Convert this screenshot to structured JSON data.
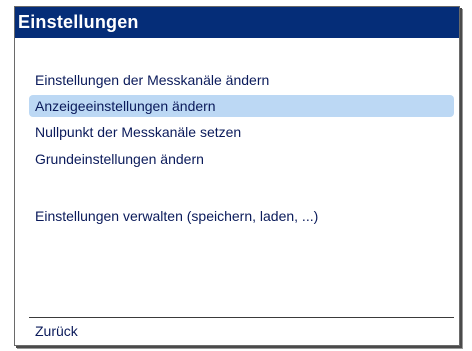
{
  "window": {
    "title": "Einstellungen"
  },
  "menu": {
    "items": [
      {
        "label": "Einstellungen der Messkanäle ändern",
        "selected": false
      },
      {
        "label": "Anzeigeeinstellungen ändern",
        "selected": true
      },
      {
        "label": "Nullpunkt der Messkanäle setzen",
        "selected": false
      },
      {
        "label": "Grundeinstellungen ändern",
        "selected": false
      },
      {
        "label": "Einstellungen verwalten (speichern, laden, ...)",
        "selected": false
      }
    ]
  },
  "footer": {
    "back_label": "Zurück"
  },
  "colors": {
    "title_bar": "#052d78",
    "selection": "#bcd8f4",
    "text": "#0a1a5a"
  }
}
